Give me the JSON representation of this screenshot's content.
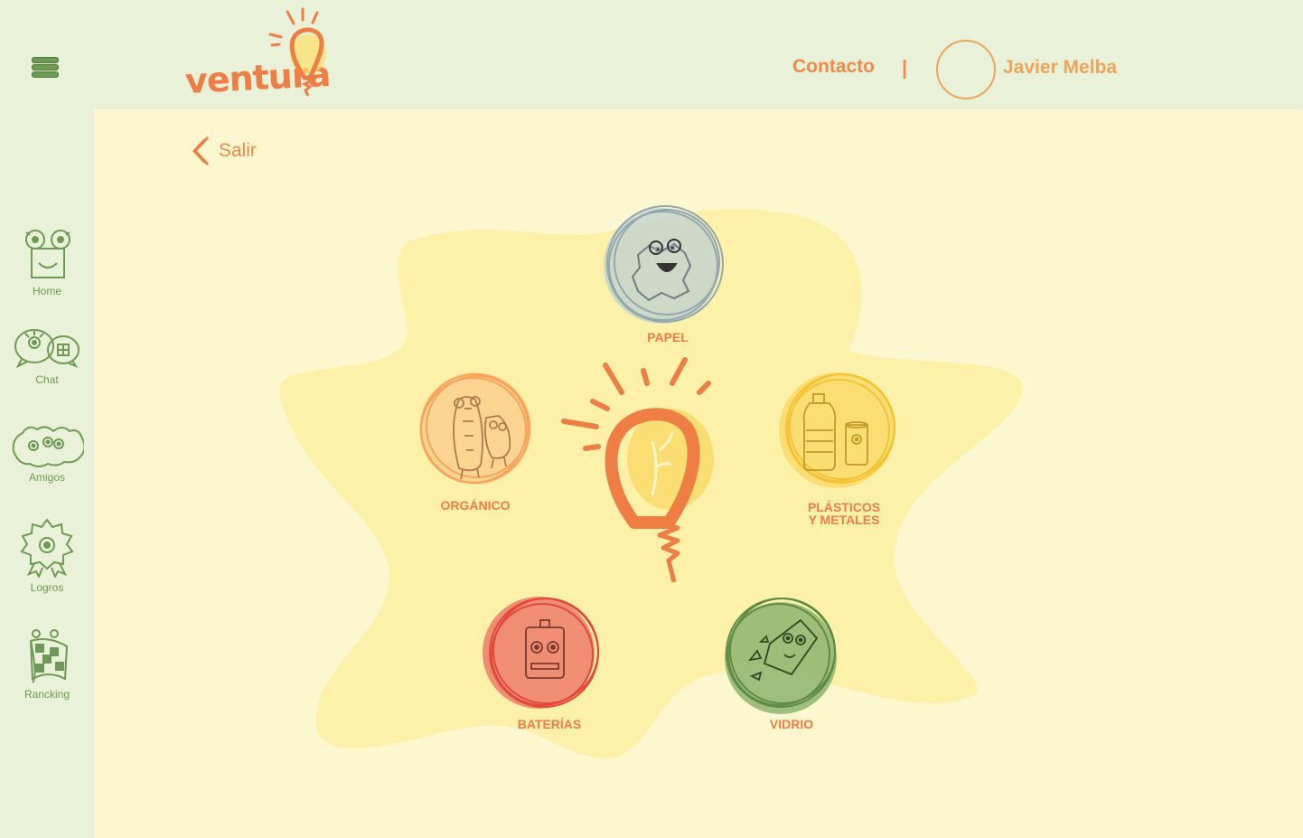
{
  "header": {
    "logo_text": "ventura",
    "menu_icon": "hamburger-menu-icon",
    "contact_label": "Contacto",
    "divider": "|",
    "user_name": "Javier Melba"
  },
  "sidebar": {
    "items": [
      {
        "label": "Home",
        "icon": "home-monster-icon"
      },
      {
        "label": "Chat",
        "icon": "chat-monster-icon"
      },
      {
        "label": "Amigos",
        "icon": "friends-monster-icon"
      },
      {
        "label": "Logros",
        "icon": "achievement-badge-icon"
      },
      {
        "label": "Rancking",
        "icon": "ranking-flag-icon"
      }
    ]
  },
  "back": {
    "label": "Salir",
    "icon": "chevron-left-icon"
  },
  "categories": [
    {
      "label": "PAPEL",
      "icon": "paper-monster-icon",
      "color": "#b9cdd3"
    },
    {
      "label": "ORGÁNICO",
      "icon": "organic-monster-icon",
      "color": "#fbc98a"
    },
    {
      "label_line1": "PLÁSTICOS",
      "label_line2": "Y METALES",
      "icon": "plastic-bottle-icon",
      "color": "#f8d65c"
    },
    {
      "label": "BATERÍAS",
      "icon": "battery-monster-icon",
      "color": "#ec7d69"
    },
    {
      "label": "VIDRIO",
      "icon": "glass-monster-icon",
      "color": "#8db470"
    }
  ],
  "colors": {
    "accent": "#ef7e44",
    "green": "#6f9a56",
    "header_bg": "#e9f1d8",
    "page_bg": "#fdf7d0",
    "splash": "#fcef9f"
  }
}
